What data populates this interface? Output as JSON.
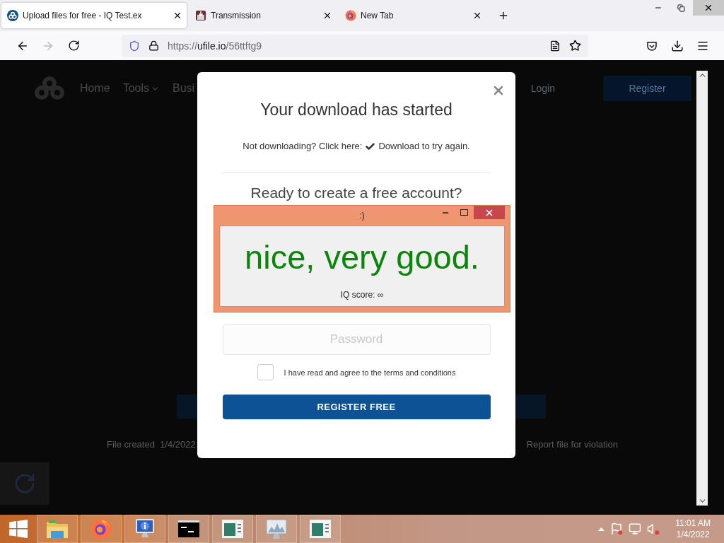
{
  "browser": {
    "tabs": [
      {
        "title": "Upload files for free - IQ Test.ex",
        "selected": true
      },
      {
        "title": "Transmission",
        "selected": false
      },
      {
        "title": "New Tab",
        "selected": false
      }
    ],
    "address": {
      "scheme": "https://",
      "host": "ufile.io",
      "path": "/56ttftg9"
    }
  },
  "page": {
    "nav": [
      {
        "label": "Home",
        "dropdown": false
      },
      {
        "label": "Tools",
        "dropdown": true
      },
      {
        "label": "Busi",
        "dropdown": false
      }
    ],
    "login": "Login",
    "register": "Register",
    "file_created": "File created  1/4/2022",
    "report": "Report file for violation"
  },
  "modal": {
    "title": "Your download has started",
    "retry_prefix": "Not downloading? Click here:",
    "retry_link": "Download to try again.",
    "heading": "Ready to create a free account?",
    "password_placeholder": "Password",
    "terms": {
      "label": "I have read and agree to the terms and conditions",
      "checked": false
    },
    "submit": "REGISTER FREE"
  },
  "popup": {
    "title": ":)",
    "message": "nice, very good.",
    "score": "IQ score: ∞"
  },
  "taskbar": {
    "apps": [
      {
        "kind": "folder"
      },
      {
        "kind": "firefox"
      },
      {
        "kind": "info"
      },
      {
        "kind": "console"
      },
      {
        "kind": "window"
      },
      {
        "kind": "monitor"
      },
      {
        "kind": "window"
      }
    ],
    "time": "11:01 AM",
    "date": "1/4/2022"
  }
}
